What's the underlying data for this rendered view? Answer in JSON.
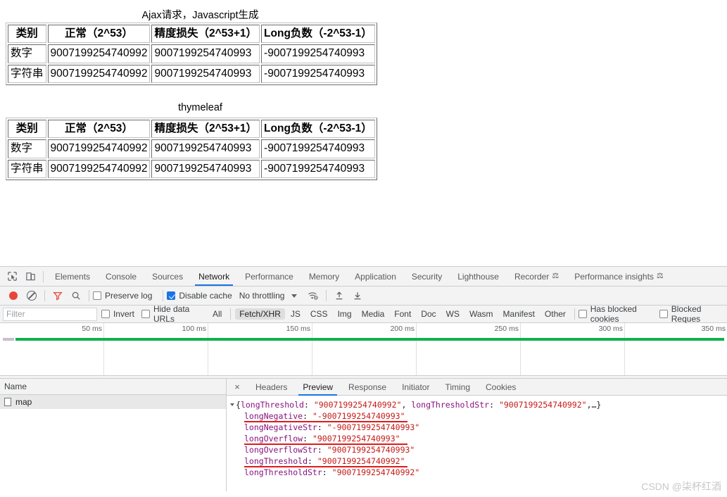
{
  "page": {
    "tables": [
      {
        "caption": "Ajax请求，Javascript生成",
        "headers": [
          "类别",
          "正常（2^53）",
          "精度损失（2^53+1）",
          "Long负数（-2^53-1）"
        ],
        "rows": [
          [
            "数字",
            "9007199254740992",
            "9007199254740993",
            "-9007199254740993"
          ],
          [
            "字符串",
            "9007199254740992",
            "9007199254740993",
            "-9007199254740993"
          ]
        ]
      },
      {
        "caption": "thymeleaf",
        "headers": [
          "类别",
          "正常（2^53）",
          "精度损失（2^53+1）",
          "Long负数（-2^53-1）"
        ],
        "rows": [
          [
            "数字",
            "9007199254740992",
            "9007199254740993",
            "-9007199254740993"
          ],
          [
            "字符串",
            "9007199254740992",
            "9007199254740993",
            "-9007199254740993"
          ]
        ]
      }
    ]
  },
  "devtools": {
    "tabs": [
      {
        "label": "Elements",
        "active": false,
        "experimental": false
      },
      {
        "label": "Console",
        "active": false,
        "experimental": false
      },
      {
        "label": "Sources",
        "active": false,
        "experimental": false
      },
      {
        "label": "Network",
        "active": true,
        "experimental": false
      },
      {
        "label": "Performance",
        "active": false,
        "experimental": false
      },
      {
        "label": "Memory",
        "active": false,
        "experimental": false
      },
      {
        "label": "Application",
        "active": false,
        "experimental": false
      },
      {
        "label": "Security",
        "active": false,
        "experimental": false
      },
      {
        "label": "Lighthouse",
        "active": false,
        "experimental": false
      },
      {
        "label": "Recorder",
        "active": false,
        "experimental": true
      },
      {
        "label": "Performance insights",
        "active": false,
        "experimental": true
      }
    ],
    "icons": {
      "inspect": "inspect-element-icon",
      "device": "device-toolbar-icon",
      "record": "record-icon",
      "clear": "clear-icon",
      "filter": "filter-icon",
      "search": "search-icon",
      "throttle": "network-conditions-icon",
      "import": "import-har-icon",
      "export": "export-har-icon"
    },
    "toolbar": {
      "preserve_log_label": "Preserve log",
      "preserve_log_checked": false,
      "disable_cache_label": "Disable cache",
      "disable_cache_checked": true,
      "throttling_label": "No throttling"
    },
    "filterbar": {
      "filter_placeholder": "Filter",
      "filter_value": "",
      "invert_label": "Invert",
      "invert_checked": false,
      "hide_data_urls_label": "Hide data URLs",
      "hide_data_urls_checked": false,
      "types": [
        {
          "label": "All",
          "selected": false
        },
        {
          "label": "Fetch/XHR",
          "selected": true
        },
        {
          "label": "JS",
          "selected": false
        },
        {
          "label": "CSS",
          "selected": false
        },
        {
          "label": "Img",
          "selected": false
        },
        {
          "label": "Media",
          "selected": false
        },
        {
          "label": "Font",
          "selected": false
        },
        {
          "label": "Doc",
          "selected": false
        },
        {
          "label": "WS",
          "selected": false
        },
        {
          "label": "Wasm",
          "selected": false
        },
        {
          "label": "Manifest",
          "selected": false
        },
        {
          "label": "Other",
          "selected": false
        }
      ],
      "has_blocked_cookies_label": "Has blocked cookies",
      "has_blocked_cookies_checked": false,
      "blocked_requests_label": "Blocked Reques",
      "blocked_requests_checked": false
    },
    "overview": {
      "ticks": [
        "50 ms",
        "100 ms",
        "150 ms",
        "200 ms",
        "250 ms",
        "300 ms",
        "350 ms"
      ],
      "bar_color": "#0fb14d"
    },
    "requests": {
      "column_header": "Name",
      "rows": [
        {
          "name": "map",
          "selected": true
        }
      ]
    },
    "details": {
      "close_label": "×",
      "tabs": [
        {
          "label": "Headers",
          "active": false
        },
        {
          "label": "Preview",
          "active": true
        },
        {
          "label": "Response",
          "active": false
        },
        {
          "label": "Initiator",
          "active": false
        },
        {
          "label": "Timing",
          "active": false
        },
        {
          "label": "Cookies",
          "active": false
        }
      ],
      "preview": {
        "summary_prefix": "{",
        "summary_key1": "longThreshold",
        "summary_val1": "\"9007199254740992\"",
        "summary_key2": "longThresholdStr",
        "summary_val2": "\"9007199254740992\"",
        "summary_suffix": ",…}",
        "entries": [
          {
            "key": "longNegative",
            "value": "\"-9007199254740993\"",
            "highlighted": true
          },
          {
            "key": "longNegativeStr",
            "value": "\"-9007199254740993\"",
            "highlighted": false
          },
          {
            "key": "longOverflow",
            "value": "\"9007199254740993\"",
            "highlighted": true
          },
          {
            "key": "longOverflowStr",
            "value": "\"9007199254740993\"",
            "highlighted": false
          },
          {
            "key": "longThreshold",
            "value": "\"9007199254740992\"",
            "highlighted": true
          },
          {
            "key": "longThresholdStr",
            "value": "\"9007199254740992\"",
            "highlighted": false
          }
        ]
      }
    }
  },
  "watermark": "CSDN @柒杯红酒"
}
